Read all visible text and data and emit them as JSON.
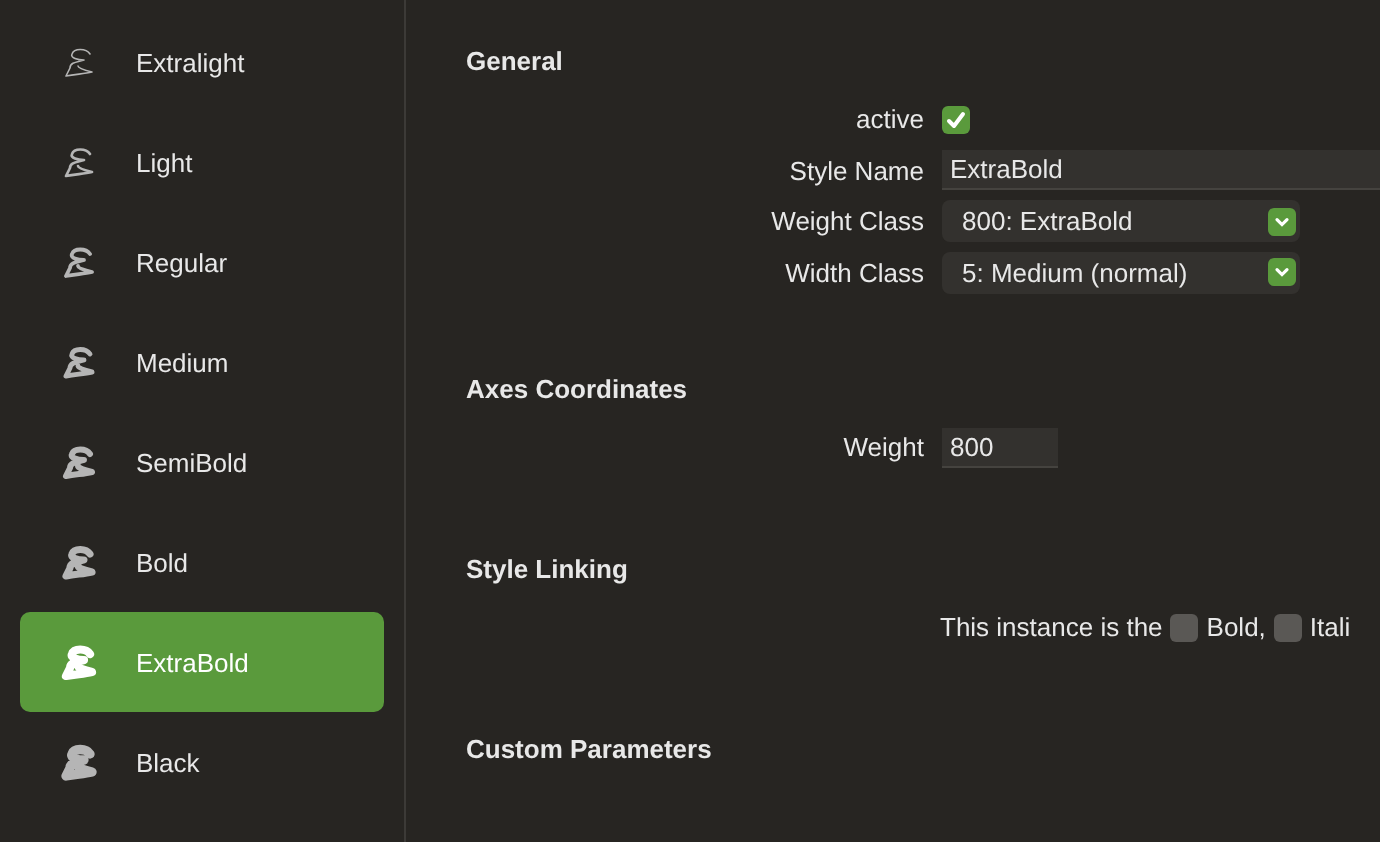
{
  "sidebar": {
    "items": [
      {
        "label": "Extralight",
        "selected": false
      },
      {
        "label": "Light",
        "selected": false
      },
      {
        "label": "Regular",
        "selected": false
      },
      {
        "label": "Medium",
        "selected": false
      },
      {
        "label": "SemiBold",
        "selected": false
      },
      {
        "label": "Bold",
        "selected": false
      },
      {
        "label": "ExtraBold",
        "selected": true
      },
      {
        "label": "Black",
        "selected": false
      }
    ]
  },
  "sections": [
    {
      "title": "General",
      "rows": [
        {
          "kind": "checkbox",
          "label": "active",
          "checked": true
        },
        {
          "kind": "text",
          "label": "Style Name",
          "value": "ExtraBold"
        },
        {
          "kind": "select",
          "label": "Weight Class",
          "value": "800: ExtraBold"
        },
        {
          "kind": "select",
          "label": "Width Class",
          "value": "5: Medium (normal)"
        }
      ]
    },
    {
      "title": "Axes Coordinates",
      "rows": [
        {
          "kind": "number",
          "label": "Weight",
          "value": "800"
        }
      ]
    },
    {
      "title": "Style Linking",
      "rows": [
        {
          "kind": "linking",
          "text": "This instance is the",
          "options": [
            {
              "label": "Bold,",
              "checked": false
            },
            {
              "label": "Itali",
              "checked": false
            }
          ]
        }
      ]
    },
    {
      "title": "Custom Parameters"
    }
  ]
}
